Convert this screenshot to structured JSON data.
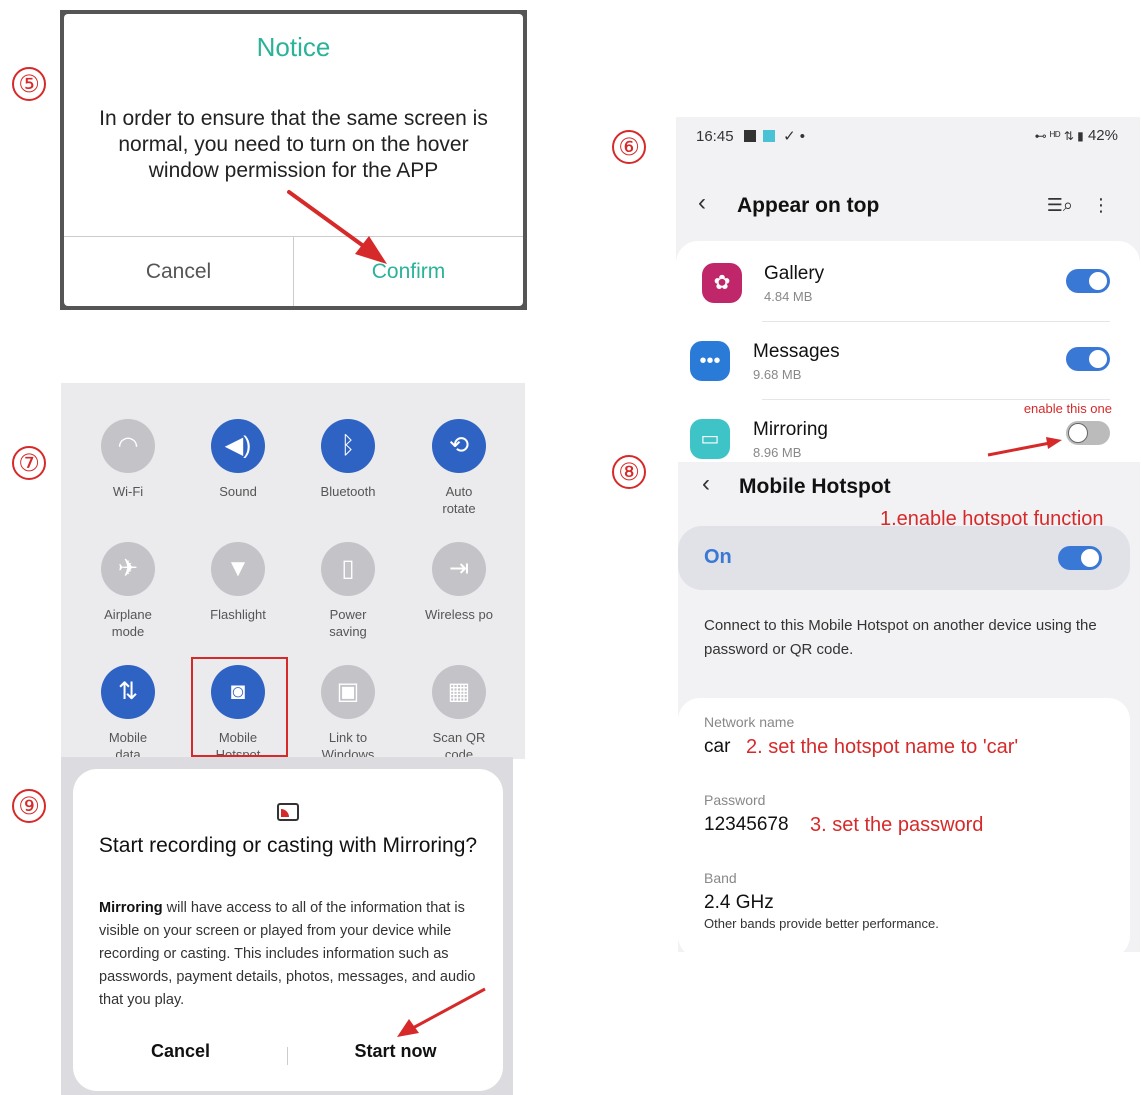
{
  "steps": [
    "⑤",
    "⑥",
    "⑦",
    "⑧",
    "⑨"
  ],
  "panel5": {
    "title": "Notice",
    "body": "In order to ensure that the same screen is normal, you need to turn on the hover window permission for the APP",
    "cancel": "Cancel",
    "confirm": "Confirm"
  },
  "panel6": {
    "time": "16:45",
    "battery": "42%",
    "title": "Appear on top",
    "apps": [
      {
        "name": "Gallery",
        "size": "4.84 MB",
        "enabled": true,
        "icon": "gallery-icon"
      },
      {
        "name": "Messages",
        "size": "9.68 MB",
        "enabled": true,
        "icon": "messages-icon"
      },
      {
        "name": "Mirroring",
        "size": "8.96 MB",
        "enabled": false,
        "icon": "mirroring-icon"
      }
    ],
    "note": "enable this one"
  },
  "panel7": {
    "tiles": [
      {
        "label": "Wi-Fi",
        "on": false,
        "icon": "wifi-icon"
      },
      {
        "label": "Sound",
        "on": true,
        "icon": "sound-icon"
      },
      {
        "label": "Bluetooth",
        "on": true,
        "icon": "bluetooth-icon"
      },
      {
        "label": "Auto rotate",
        "on": true,
        "icon": "rotate-icon"
      },
      {
        "label": "Airplane mode",
        "on": false,
        "icon": "airplane-icon"
      },
      {
        "label": "Flashlight",
        "on": false,
        "icon": "flashlight-icon"
      },
      {
        "label": "Power saving",
        "on": false,
        "icon": "battery-icon"
      },
      {
        "label": "Wireless po",
        "on": false,
        "icon": "wireless-power-icon"
      },
      {
        "label": "Mobile data",
        "on": true,
        "icon": "data-icon"
      },
      {
        "label": "Mobile Hotspot",
        "on": true,
        "icon": "hotspot-icon"
      },
      {
        "label": "Link to Windows",
        "on": false,
        "icon": "link-windows-icon"
      },
      {
        "label": "Scan QR code",
        "on": false,
        "icon": "qr-icon"
      }
    ]
  },
  "panel8": {
    "title": "Mobile Hotspot",
    "note1": "1.enable hotspot function",
    "on_label": "On",
    "description": "Connect to this Mobile Hotspot on another device using the password or QR code.",
    "network_label": "Network name",
    "network_value": "car",
    "note2": "2. set the hotspot name to 'car'",
    "password_label": "Password",
    "password_value": "12345678",
    "note3": "3. set the password",
    "band_label": "Band",
    "band_value": "2.4 GHz",
    "band_sub": "Other bands provide better performance."
  },
  "panel9": {
    "title": "Start recording or casting with Mirroring?",
    "app_name": "Mirroring",
    "body": " will have access to all of the information that is visible on your screen or played from your device while recording or casting. This includes information such as passwords, payment details, photos, messages, and audio that you play.",
    "cancel": "Cancel",
    "start": "Start now"
  }
}
